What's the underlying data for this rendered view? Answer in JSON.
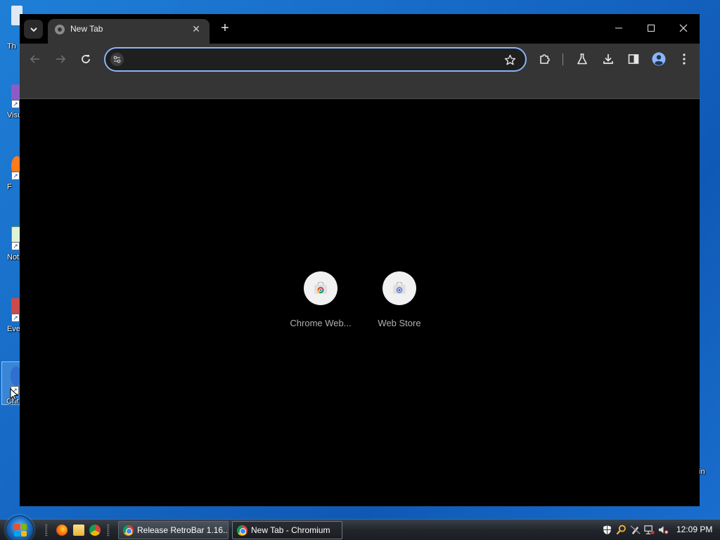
{
  "desktop": {
    "icons": [
      {
        "label": "Th"
      },
      {
        "label": "Visu"
      },
      {
        "label": "F"
      },
      {
        "label": "Not"
      },
      {
        "label": "Eve"
      },
      {
        "label": "Chr"
      }
    ],
    "right_label": "in"
  },
  "browser": {
    "tab": {
      "title": "New Tab",
      "close_glyph": "✕"
    },
    "new_tab_glyph": "+",
    "window_controls": {
      "minimize": "minimize-icon",
      "maximize": "maximize-icon",
      "close": "close-icon"
    },
    "omnibox": {
      "value": "",
      "placeholder": ""
    },
    "shortcuts": [
      {
        "label": "Chrome Web...",
        "icon": "chrome-web-store-icon"
      },
      {
        "label": "Web Store",
        "icon": "web-store-icon"
      }
    ],
    "colors": {
      "accent": "#8ab4f8",
      "toolbar": "#353535",
      "content": "#000000"
    }
  },
  "taskbar": {
    "buttons": [
      {
        "label": "Release RetroBar 1.16..."
      },
      {
        "label": "New Tab - Chromium"
      }
    ],
    "clock": "12:09 PM"
  }
}
